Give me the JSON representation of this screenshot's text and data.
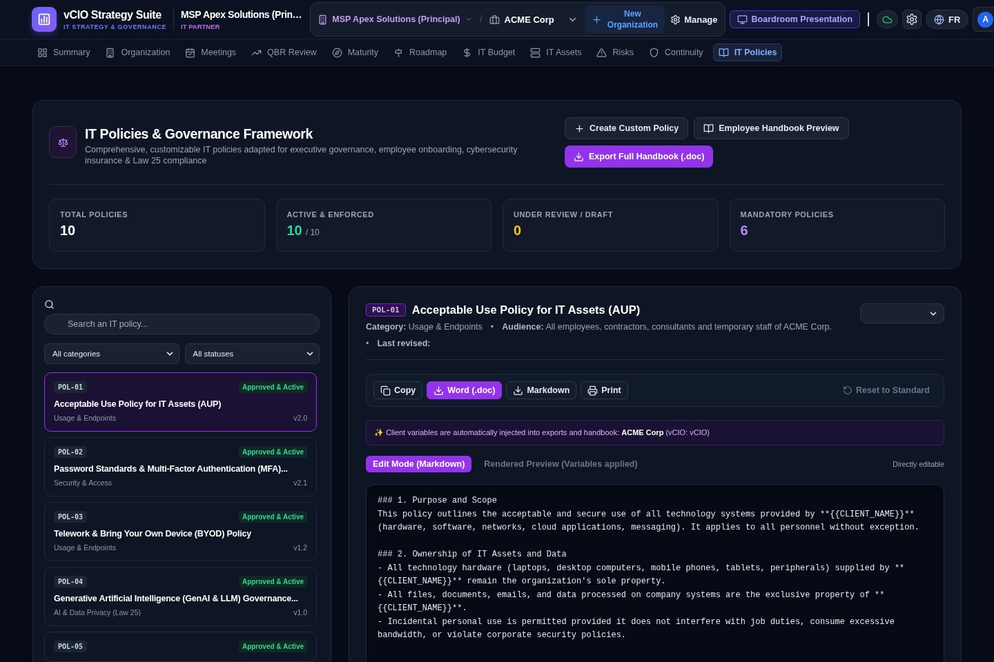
{
  "app": {
    "title": "vCIO Strategy Suite",
    "subtitle": "IT STRATEGY & GOVERNANCE",
    "partner_name": "MSP Apex Solutions (Prin…",
    "partner_role": "IT PARTNER"
  },
  "context": {
    "principal": "MSP Apex Solutions (Principal)",
    "separator": "/",
    "client": "ACME Corp",
    "new_org": "New Organization",
    "manage": "Manage"
  },
  "actions": {
    "presentation": "Boardroom Presentation",
    "language": "FR",
    "avatar": "A"
  },
  "nav": [
    {
      "label": "Summary",
      "selected": false
    },
    {
      "label": "Organization",
      "selected": false
    },
    {
      "label": "Meetings",
      "selected": false
    },
    {
      "label": "QBR Review",
      "selected": false
    },
    {
      "label": "Maturity",
      "selected": false
    },
    {
      "label": "Roadmap",
      "selected": false
    },
    {
      "label": "IT Budget",
      "selected": false
    },
    {
      "label": "IT Assets",
      "selected": false
    },
    {
      "label": "Risks",
      "selected": false
    },
    {
      "label": "Continuity",
      "selected": false
    },
    {
      "label": "IT Policies",
      "selected": true
    }
  ],
  "page_header": {
    "title": "IT Policies & Governance Framework",
    "description": "Comprehensive, customizable IT policies adapted for executive governance, employee onboarding, cybersecurity insurance & Law 25 compliance",
    "buttons": [
      {
        "label": "Create Custom Policy",
        "kind": "secondary"
      },
      {
        "label": "Employee Handbook Preview",
        "kind": "secondary"
      },
      {
        "label": "Export Full Handbook (.doc)",
        "kind": "primary"
      }
    ]
  },
  "stats": [
    {
      "label": "TOTAL POLICIES",
      "value": "10",
      "color": "#ffffff"
    },
    {
      "label": "ACTIVE & ENFORCED",
      "value": "10",
      "suffix": "/ 10",
      "color": "#34d399"
    },
    {
      "label": "UNDER REVIEW / DRAFT",
      "value": "0",
      "color": "#fbbf24"
    },
    {
      "label": "MANDATORY POLICIES",
      "value": "6",
      "color": "#c084fc"
    }
  ],
  "policy_list": {
    "search_placeholder": "Search an IT policy...",
    "category_filter": "All categories",
    "status_filter": "All statuses",
    "items": [
      {
        "code": "POL-01",
        "status": "Approved & Active",
        "title": "Acceptable Use Policy for IT Assets (AUP)",
        "category": "Usage & Endpoints",
        "version": "v2.0",
        "selected": true
      },
      {
        "code": "POL-02",
        "status": "Approved & Active",
        "title": "Password Standards & Multi-Factor Authentication (MFA)...",
        "category": "Security & Access",
        "version": "v2.1",
        "selected": false
      },
      {
        "code": "POL-03",
        "status": "Approved & Active",
        "title": "Telework & Bring Your Own Device (BYOD) Policy",
        "category": "Usage & Endpoints",
        "version": "v1.2",
        "selected": false
      },
      {
        "code": "POL-04",
        "status": "Approved & Active",
        "title": "Generative Artificial Intelligence (GenAI & LLM) Governance...",
        "category": "AI & Data Privacy (Law 25)",
        "version": "v1.0",
        "selected": false
      },
      {
        "code": "POL-05",
        "status": "Approved & Active",
        "selected": false
      }
    ]
  },
  "detail": {
    "code": "POL-01",
    "title": "Acceptable Use Policy for IT Assets (AUP)",
    "meta_lines": [
      [
        {
          "kind": "text",
          "text": "**Category:** Usage & Endpoints"
        },
        {
          "kind": "separator",
          "text": "•"
        },
        {
          "kind": "text",
          "text": "**Audience:** All employees, contractors, consultants and temporary staff of ACME Corp."
        }
      ],
      [
        {
          "kind": "separator",
          "text": "•"
        },
        {
          "kind": "text",
          "text": "**Last revised:**"
        }
      ]
    ],
    "toolbar": [
      {
        "label": "Copy",
        "kind": "secondary"
      },
      {
        "label": "Word (.doc)",
        "kind": "primary"
      },
      {
        "label": "Markdown",
        "kind": "secondary"
      },
      {
        "label": "Print",
        "kind": "secondary"
      }
    ],
    "reset": "Reset to Standard",
    "notice": "✨ Client variables are automatically injected into exports and handbook: **ACME Corp** (vCIO: vCIO)",
    "modes": [
      {
        "label": "Edit Mode (Markdown)",
        "selected": true
      },
      {
        "label": "Rendered Preview (Variables applied)",
        "selected": false
      }
    ],
    "editable_note": "Directly editable",
    "content": "### 1. Purpose and Scope\nThis policy outlines the acceptable and secure use of all technology systems provided by **{{CLIENT_NAME}}** (hardware, software, networks, cloud applications, messaging). It applies to all personnel without exception.\n\n### 2. Ownership of IT Assets and Data\n- All technology hardware (laptops, desktop computers, mobile phones, tablets, peripherals) supplied by **{{CLIENT_NAME}}** remain the organization's sole property.\n- All files, documents, emails, and data processed on company systems are the exclusive property of **{{CLIENT_NAME}}**.\n- Incidental personal use is permitted provided it does not interfere with job duties, consume excessive bandwidth, or violate corporate security policies."
  }
}
